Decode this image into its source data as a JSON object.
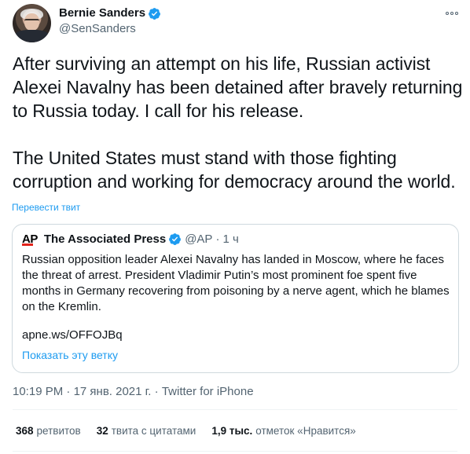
{
  "author": {
    "display_name": "Bernie Sanders",
    "handle": "@SenSanders"
  },
  "tweet": {
    "paragraphs": [
      "After surviving an attempt on his life, Russian activist Alexei Navalny has been detained after bravely returning to Russia today. I call for his release.",
      "The United States must stand with those fighting corruption and working for democracy around the world."
    ],
    "translate_label": "Перевести твит",
    "meta": {
      "time": "10:19 PM",
      "date": "17 янв. 2021 г.",
      "source": "Twitter for iPhone",
      "separator": "·"
    }
  },
  "quoted": {
    "logo_text": "AP",
    "display_name": "The Associated Press",
    "handle": "@AP",
    "separator": "·",
    "time": "1 ч",
    "text": "Russian opposition leader Alexei Navalny has landed in Moscow, where he faces the threat of arrest. President Vladimir Putin’s most prominent foe spent five months in Germany recovering from poisoning by a nerve agent, which he blames on the Kremlin.",
    "link": "apne.ws/OFFOJBq",
    "thread_label": "Показать эту ветку"
  },
  "stats": [
    {
      "count": "368",
      "label": "ретвитов"
    },
    {
      "count": "32",
      "label": "твита с цитатами"
    },
    {
      "count": "1,9 тыс.",
      "label": "отметок «Нравится»"
    }
  ],
  "colors": {
    "accent": "#1d9bf0",
    "text": "#0f1419",
    "secondary": "#536471",
    "border": "#cfd9de",
    "ap_red": "#e2231a"
  },
  "icons": {
    "verified": "verified-badge-icon",
    "more": "more-options-icon"
  }
}
